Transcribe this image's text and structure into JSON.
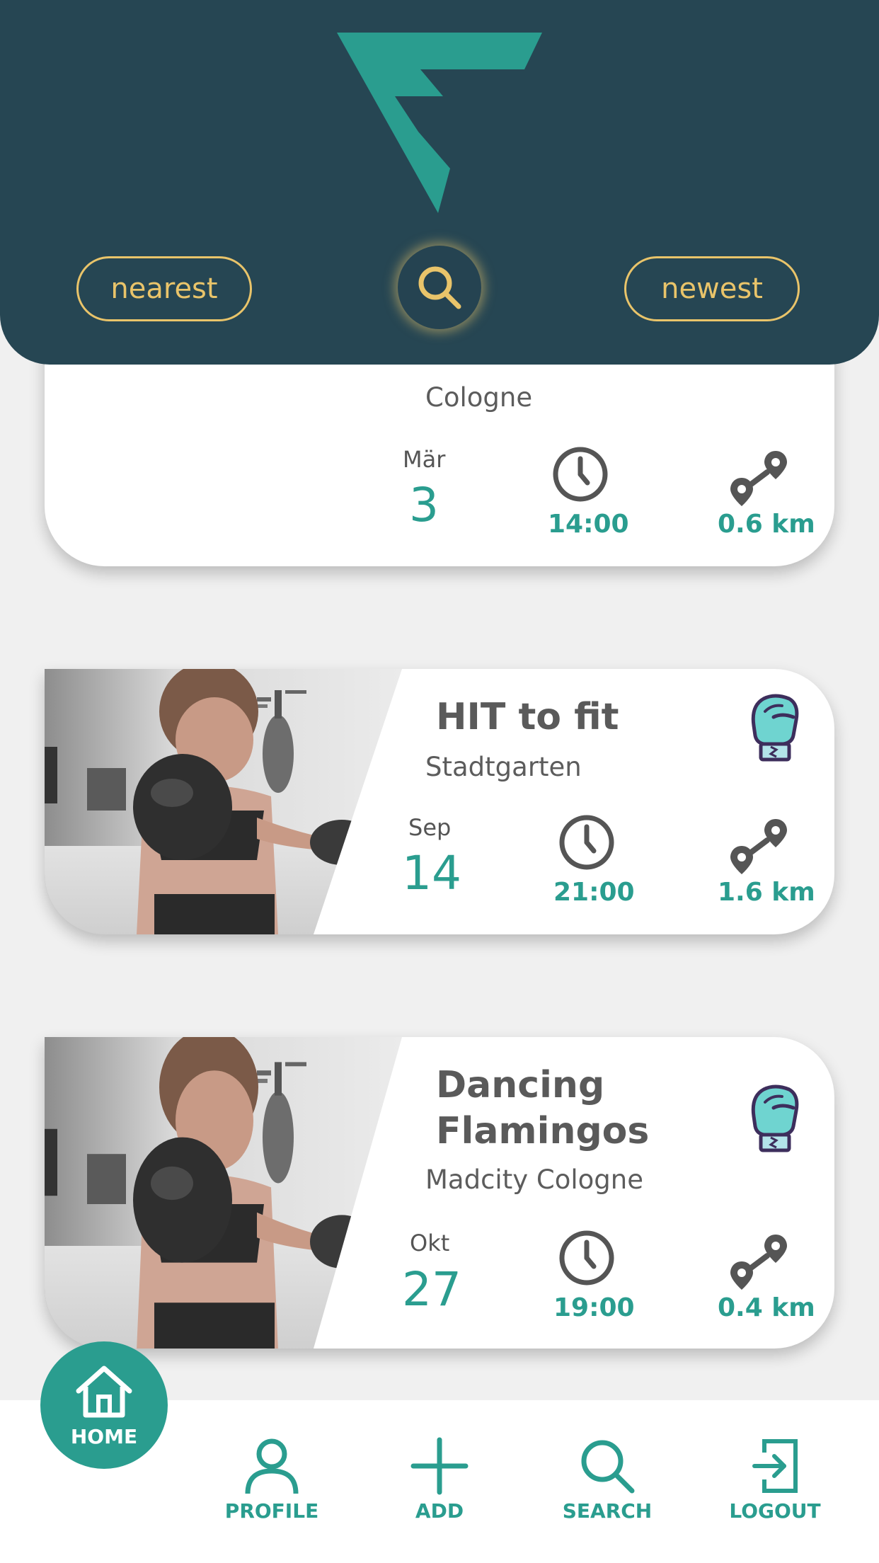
{
  "colors": {
    "header_bg": "#264653",
    "accent_teal": "#2a9d8f",
    "accent_gold": "#e9c46a",
    "glove_fill": "#6fd4d0",
    "glove_outline": "#3d2e5c"
  },
  "header": {
    "logo_icon": "f-logo-icon",
    "filter_left": "nearest",
    "filter_right": "newest",
    "search_icon": "search-icon"
  },
  "cards": [
    {
      "title": "",
      "location": "Cologne",
      "month": "Mär",
      "day": "3",
      "time": "14:00",
      "distance": "0.6 km"
    },
    {
      "title": "HIT to fit",
      "location": "Stadtgarten",
      "month": "Sep",
      "day": "14",
      "time": "21:00",
      "distance": "1.6 km",
      "icon": "boxing-glove-icon"
    },
    {
      "title_line1": "Dancing",
      "title_line2": "Flamingos",
      "location": "Madcity Cologne",
      "month": "Okt",
      "day": "27",
      "time": "19:00",
      "distance": "0.4 km",
      "icon": "boxing-glove-icon"
    }
  ],
  "nav": {
    "home": "HOME",
    "profile": "PROFILE",
    "add": "ADD",
    "search": "SEARCH",
    "logout": "LOGOUT"
  }
}
